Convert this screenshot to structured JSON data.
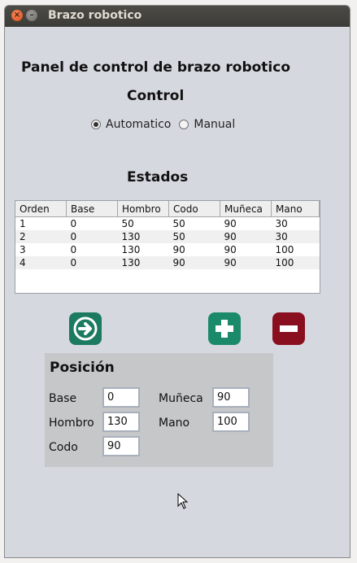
{
  "window": {
    "title": "Brazo robotico"
  },
  "header": {
    "title": "Panel de control de brazo robotico"
  },
  "control": {
    "title": "Control",
    "options": [
      {
        "label": "Automatico",
        "selected": true
      },
      {
        "label": "Manual",
        "selected": false
      }
    ]
  },
  "estados": {
    "title": "Estados",
    "columns": [
      "Orden",
      "Base",
      "Hombro",
      "Codo",
      "Muñeca",
      "Mano"
    ],
    "rows": [
      [
        "1",
        "0",
        "50",
        "50",
        "90",
        "30"
      ],
      [
        "2",
        "0",
        "130",
        "50",
        "90",
        "30"
      ],
      [
        "3",
        "0",
        "130",
        "90",
        "90",
        "100"
      ],
      [
        "4",
        "0",
        "130",
        "90",
        "90",
        "100"
      ]
    ]
  },
  "buttons": {
    "next_icon": "arrow-right-icon",
    "add_icon": "plus-icon",
    "remove_icon": "minus-icon",
    "colors": {
      "next": "#1b7a60",
      "add": "#1b8a6a",
      "remove": "#8a0f1e"
    }
  },
  "posicion": {
    "title": "Posición",
    "base": {
      "label": "Base",
      "value": "0"
    },
    "hombro": {
      "label": "Hombro",
      "value": "130"
    },
    "codo": {
      "label": "Codo",
      "value": "90"
    },
    "muneca": {
      "label": "Muñeca",
      "value": "90"
    },
    "mano": {
      "label": "Mano",
      "value": "100"
    }
  }
}
